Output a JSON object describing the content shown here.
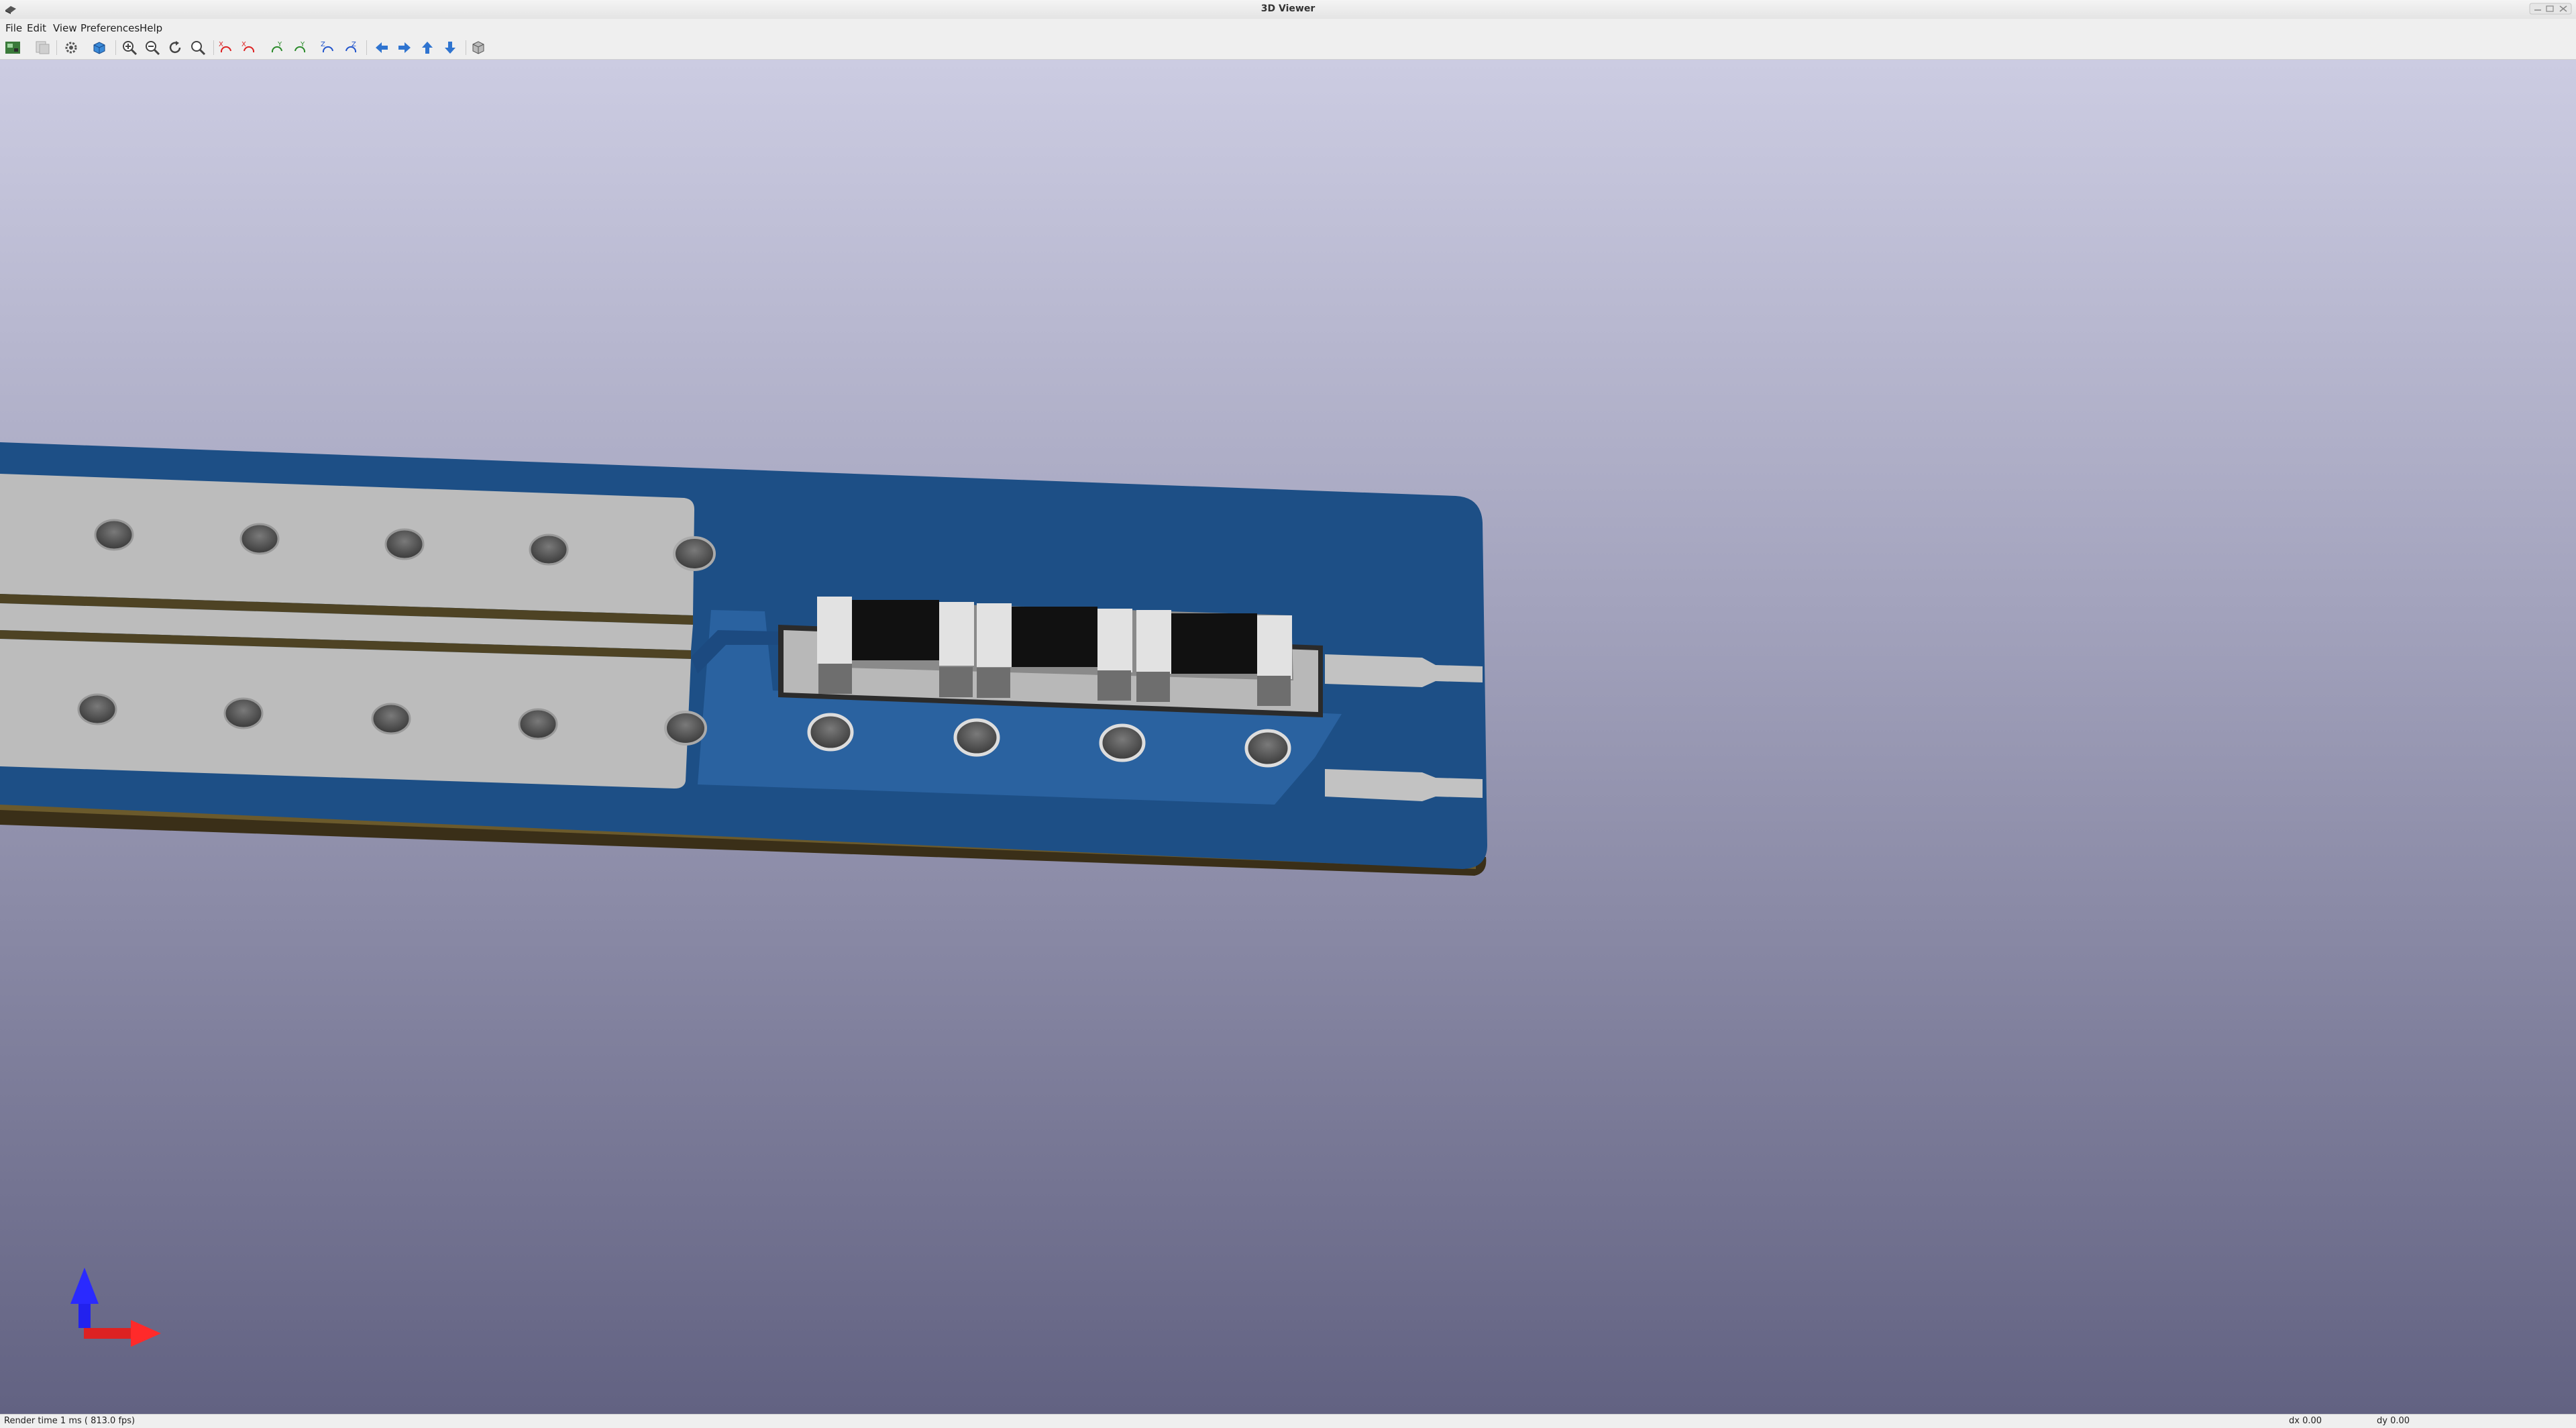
{
  "window": {
    "title": "3D Viewer"
  },
  "menu": {
    "items": [
      {
        "label": "File"
      },
      {
        "label": "Edit"
      },
      {
        "label": "View"
      },
      {
        "label": "Preferences"
      },
      {
        "label": "Help"
      }
    ]
  },
  "toolbar": {
    "buttons": [
      {
        "icon": "render-options-icon"
      },
      {
        "icon": "copy-image-icon"
      },
      {
        "icon": "settings-icon"
      },
      {
        "icon": "raytracing-icon"
      },
      {
        "icon": "zoom-in-icon"
      },
      {
        "icon": "zoom-out-icon"
      },
      {
        "icon": "redraw-icon"
      },
      {
        "icon": "zoom-fit-icon"
      },
      {
        "icon": "rotate-x-cw-icon"
      },
      {
        "icon": "rotate-x-ccw-icon"
      },
      {
        "icon": "rotate-y-cw-icon"
      },
      {
        "icon": "rotate-y-ccw-icon"
      },
      {
        "icon": "rotate-z-cw-icon"
      },
      {
        "icon": "rotate-z-ccw-icon"
      },
      {
        "icon": "pan-left-icon"
      },
      {
        "icon": "pan-right-icon"
      },
      {
        "icon": "pan-up-icon"
      },
      {
        "icon": "pan-down-icon"
      },
      {
        "icon": "orthographic-icon"
      }
    ]
  },
  "colors": {
    "board_blue": "#1d4f86",
    "board_blue_light": "#2f69a6",
    "copper_pad": "#bdbdbd",
    "board_edge": "#4b3d1f",
    "component_body": "#121212",
    "axis_z": "#2222ee",
    "axis_x": "#ee2222"
  },
  "status": {
    "render_time": "Render time 1 ms ( 813.0 fps)",
    "dx": "dx 0.00",
    "dy": "dy 0.00"
  }
}
